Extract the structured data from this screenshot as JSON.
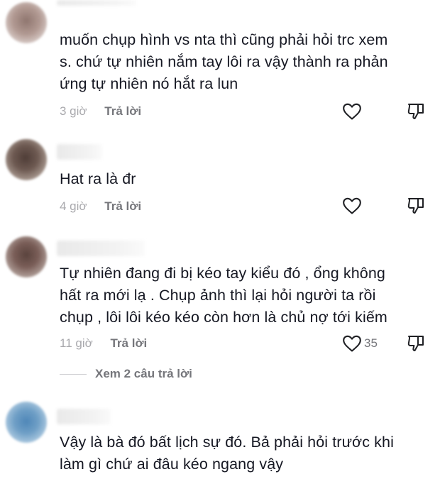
{
  "comments": [
    {
      "text": "muốn chụp hình vs nta thì cũng phải hỏi trc xem\ns. chứ tự nhiên nắm tay lôi ra vậy thành ra phản\nứng tự nhiên nó hắt ra lun",
      "time": "3 giờ",
      "reply_label": "Trả lời",
      "avatar_color": "#a88f88",
      "like_icon": "heart-outline-icon",
      "dislike_icon": "thumbs-down-icon"
    },
    {
      "text": "Hat ra là đr",
      "time": "4 giờ",
      "reply_label": "Trả lời",
      "avatar_color": "#6e5a52",
      "like_icon": "heart-outline-icon",
      "dislike_icon": "thumbs-down-icon"
    },
    {
      "text": "Tự nhiên đang đi bị kéo tay kiểu đó , ổng không\nhất ra mới lạ . Chụp ảnh thì lại hỏi người ta rồi\nchụp , lôi lôi kéo kéo còn hơn là chủ nợ tới kiếm",
      "time": "11 giờ",
      "reply_label": "Trả lời",
      "like_count": "35",
      "avatar_color": "#7a5e58",
      "like_icon": "heart-outline-icon",
      "dislike_icon": "thumbs-down-icon",
      "view_replies": "Xem 2 câu trả lời"
    },
    {
      "text": "Vậy là bà đó bất lịch sự đó. Bả phải hỏi trước khi\nlàm gì chứ ai đâu kéo ngang vậy",
      "avatar_color": "#6f9fc6"
    }
  ]
}
